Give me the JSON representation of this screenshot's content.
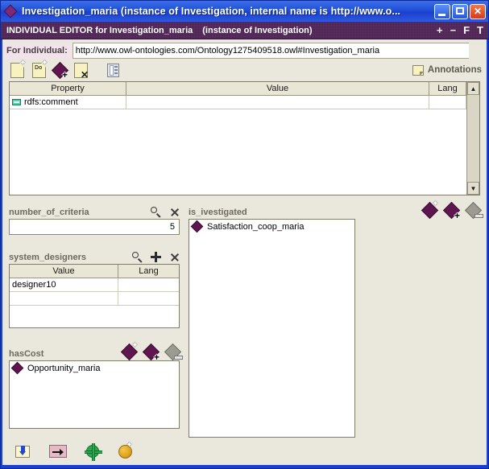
{
  "window": {
    "title": "Investigation_maria   (instance of Investigation, internal name is http://www.o...",
    "title_icon": "diamond-icon",
    "minimize_label": "minimize-icon",
    "maximize_label": "maximize-icon",
    "close_label": "✕"
  },
  "editor_header": {
    "title": "INDIVIDUAL EDITOR for Investigation_maria",
    "subtitle": "(instance of Investigation)",
    "controls": [
      "+",
      "−",
      "F",
      "T"
    ]
  },
  "individual": {
    "label": "For Individual:",
    "value": "http://www.owl-ontologies.com/Ontology1275409518.owl#Investigation_maria",
    "placeholder": ""
  },
  "toolbar": {
    "icons": [
      {
        "name": "create-annotation-icon",
        "kind": "note-new",
        "label": ""
      },
      {
        "name": "duplicate-annotation-icon",
        "kind": "note-dup",
        "label": "Do"
      },
      {
        "name": "add-instance-icon",
        "kind": "diamond-plus",
        "label": ""
      },
      {
        "name": "remove-annotation-icon",
        "kind": "note-x",
        "label": ""
      },
      {
        "name": "view-panel-icon",
        "kind": "panel",
        "label": ""
      }
    ],
    "annotations_label": "Annotations"
  },
  "property_table": {
    "columns": [
      "Property",
      "Value",
      "Lang"
    ],
    "rows": [
      {
        "property": "rdfs:comment",
        "value": "",
        "lang": ""
      }
    ],
    "scroll_up": "▲",
    "scroll_down": "▼"
  },
  "sections": {
    "number_of_criteria": {
      "label": "number_of_criteria",
      "value": "5",
      "icons": [
        "search-icon",
        "delete-icon"
      ]
    },
    "system_designers": {
      "label": "system_designers",
      "columns": [
        "Value",
        "Lang"
      ],
      "rows": [
        {
          "value": "designer10",
          "lang": ""
        },
        {
          "value": "",
          "lang": ""
        }
      ],
      "icons": [
        "search-icon",
        "add-icon",
        "delete-icon"
      ]
    },
    "hasCost": {
      "label": "hasCost",
      "items": [
        "Opportunity_maria"
      ],
      "icons": [
        "create-instance-icon",
        "add-instance-icon",
        "remove-instance-icon"
      ]
    },
    "is_ivestigated": {
      "label": "is_ivestigated",
      "items": [
        "Satisfaction_coop_maria"
      ],
      "icons": [
        "create-instance-icon",
        "add-instance-icon",
        "remove-instance-icon"
      ]
    }
  },
  "bottom_toolbar": {
    "icons": [
      {
        "name": "import-icon"
      },
      {
        "name": "move-right-icon"
      },
      {
        "name": "settings-gear-icon"
      },
      {
        "name": "instance-ball-icon"
      }
    ]
  },
  "colors": {
    "title_bar": "#1b3fcf",
    "editor_header": "#49204f",
    "client_bg": "#eae8dc",
    "diamond": "#5e1550",
    "accent_label": "#6d6a5c"
  }
}
